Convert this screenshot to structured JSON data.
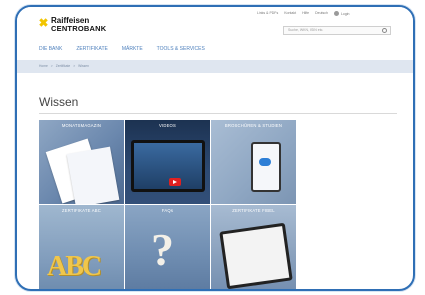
{
  "header": {
    "logo_line1": "Raiffeisen",
    "logo_line2": "CENTROBANK",
    "top_links": [
      "Links & PDFs",
      "Kontakt",
      "Hilfe",
      "Deutsch"
    ],
    "login_label": "Login",
    "search_placeholder": "Suche, WKN, ISIN etc."
  },
  "nav": [
    "DIE BANK",
    "ZERTIFIKATE",
    "MÄRKTE",
    "TOOLS & SERVICES"
  ],
  "breadcrumb": [
    "Home",
    "Zertifikate",
    "Wissen"
  ],
  "page": {
    "title": "Wissen"
  },
  "tiles": [
    {
      "label": "MONATSMAGAZIN"
    },
    {
      "label": "VIDEOS"
    },
    {
      "label": "BROSCHÜREN & STUDIEN"
    },
    {
      "label": "ZERTIFIKATE ABC"
    },
    {
      "label": "FAQs"
    },
    {
      "label": "ZERTIFIKATE FIBEL"
    }
  ],
  "colors": {
    "frame_border": "#2f6fb5",
    "nav_text": "#4f81bd",
    "breadcrumb_bar": "#dfe6f0",
    "logo_mark": "#f2c500"
  }
}
